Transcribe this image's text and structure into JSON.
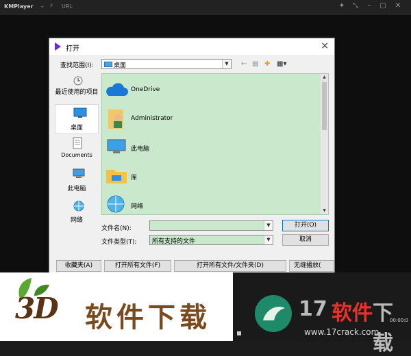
{
  "player": {
    "logo": "KMPlayer",
    "menu_glyph": "⌄",
    "url_label": "URL",
    "time": "00:00:0"
  },
  "dialog": {
    "title": "打开",
    "close_glyph": "×",
    "look_in_label": "查找范围(I):",
    "look_in_value": "桌面",
    "places": [
      {
        "label": "最近使用的项目",
        "icon": "recent-icon"
      },
      {
        "label": "桌面",
        "icon": "desktop-icon"
      },
      {
        "label": "Documents",
        "icon": "documents-icon"
      },
      {
        "label": "此电脑",
        "icon": "computer-icon"
      },
      {
        "label": "网络",
        "icon": "network-icon"
      }
    ],
    "items": [
      {
        "label": "OneDrive",
        "icon": "onedrive-icon"
      },
      {
        "label": "Administrator",
        "icon": "user-folder-icon"
      },
      {
        "label": "此电脑",
        "icon": "computer-icon"
      },
      {
        "label": "库",
        "icon": "library-folder-icon"
      },
      {
        "label": "网络",
        "icon": "network-icon"
      }
    ],
    "file_name_label": "文件名(N):",
    "file_name_value": "",
    "file_type_label": "文件类型(T):",
    "file_type_value": "所有支持的文件",
    "open_button": "打开(O)",
    "cancel_button": "取消",
    "bottom_buttons": [
      "收藏夹(A)",
      "打开所有文件(F)",
      "打开所有文件/文件夹(D)",
      "无缝播放("
    ]
  },
  "watermark": {
    "left_brand_3d": "3D",
    "left_brand_text": "软件下载",
    "right_num": "17",
    "right_text": "软件",
    "right_tail": "下载",
    "right_url": "www.17crack.com"
  },
  "colors": {
    "list_bg": "#c9e8cc",
    "dialog_bg": "#f0f0f0",
    "accent_red": "#e8332b",
    "brand_brown": "#7a4a1c"
  }
}
